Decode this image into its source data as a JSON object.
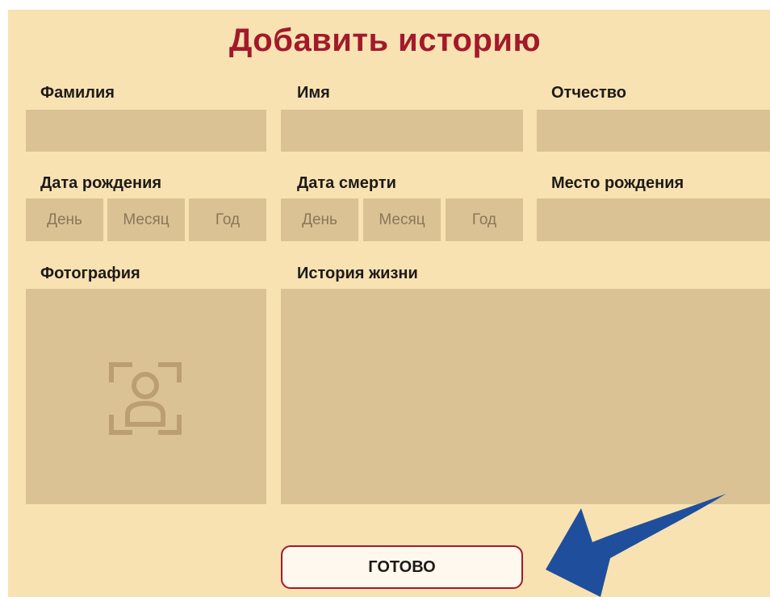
{
  "form": {
    "title": "Добавить историю",
    "last_name_label": "Фамилия",
    "first_name_label": "Имя",
    "patronymic_label": "Отчество",
    "birth_date_label": "Дата рождения",
    "death_date_label": "Дата смерти",
    "birth_place_label": "Место рождения",
    "photo_label": "Фотография",
    "life_story_label": "История жизни",
    "birth_date": {
      "day_placeholder": "День",
      "month_placeholder": "Месяц",
      "year_placeholder": "Год"
    },
    "death_date": {
      "day_placeholder": "День",
      "month_placeholder": "Месяц",
      "year_placeholder": "Год"
    },
    "submit_label": "ГОТОВО"
  },
  "icons": {
    "photo": "user-photo-icon",
    "arrow": "arrow-pointer-icon"
  },
  "colors": {
    "background": "#f8e2b2",
    "field": "#dac295",
    "title": "#a3192a",
    "button_border": "#a3192a",
    "arrow": "#1f4f9c"
  }
}
